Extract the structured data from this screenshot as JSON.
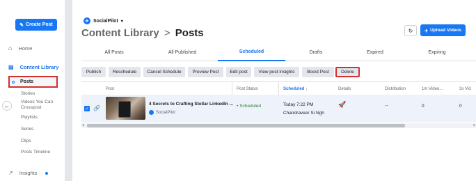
{
  "sidebar": {
    "create_post": "Create Post",
    "home": "Home",
    "content_library": "Content Library",
    "posts": "Posts",
    "sub_items": [
      "Stories",
      "Videos You Can Crosspost",
      "Playlists",
      "Series",
      "Clips",
      "Posts Timeline"
    ],
    "insights": "Insights"
  },
  "header": {
    "account_name": "SocialPilot",
    "title_parent": "Content Library",
    "separator": ">",
    "title_current": "Posts",
    "upload_label": "Upload Videos"
  },
  "tabs": [
    "All Posts",
    "All Published",
    "Scheduled",
    "Drafts",
    "Expired",
    "Expiring"
  ],
  "active_tab": "Scheduled",
  "toolbar": [
    "Publish",
    "Reschedule",
    "Cancel Schedule",
    "Preview Post",
    "Edit post",
    "View post insights",
    "Boost Post",
    "Delete"
  ],
  "table": {
    "headers": {
      "post": "Post",
      "status": "Post Status",
      "scheduled": "Scheduled ↓",
      "details": "Details",
      "distribution": "Distribution",
      "video1m": "1m Video...",
      "video3s": "3s Vid"
    },
    "row": {
      "title": "4 Secrets to Crafting Stellar LinkedIn ...",
      "source": "SocialPilot",
      "status": "Scheduled",
      "time": "Today 7:22 PM",
      "user": "Chandraveer Si Ngh",
      "distribution": "--",
      "video1m": "0",
      "video3s": "0"
    }
  },
  "colors": {
    "accent": "#1877f2",
    "highlight_border": "#d32f2f",
    "status_green": "#2e7d32"
  }
}
